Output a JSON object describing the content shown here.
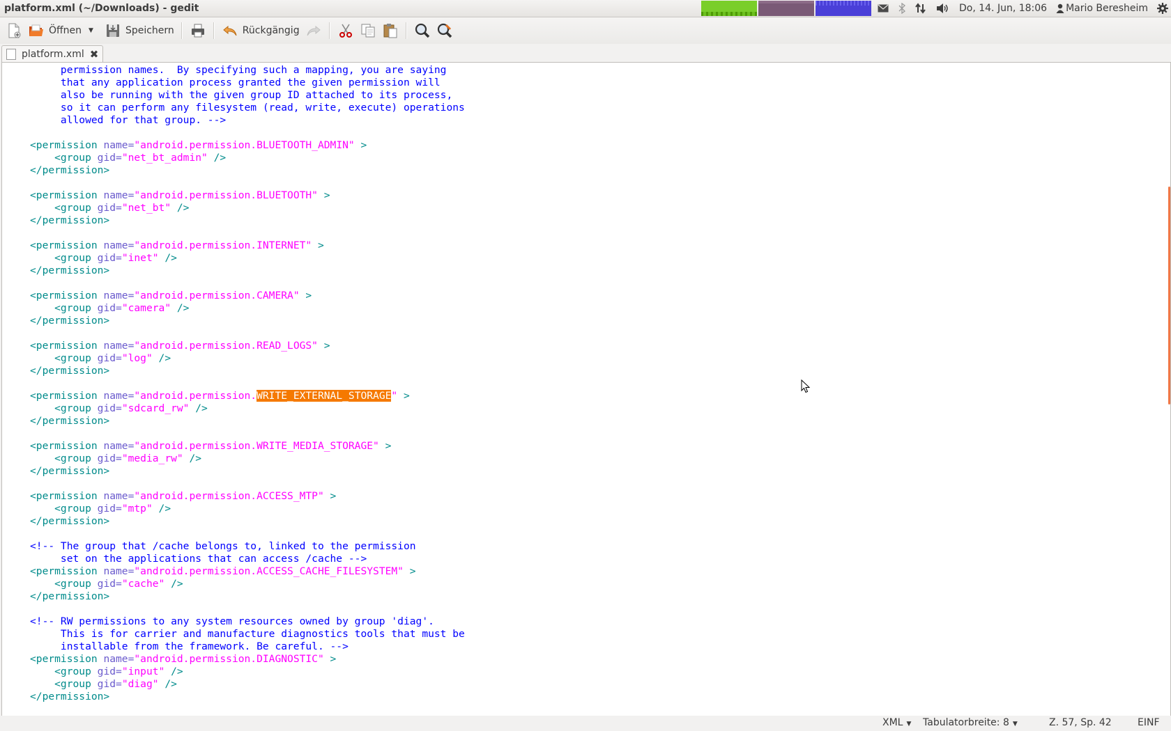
{
  "window": {
    "title": "platform.xml (~/Downloads) - gedit"
  },
  "tray": {
    "date_time": "Do, 14. Jun, 18:06",
    "user": "Mario Beresheim",
    "icons": [
      "mail-icon",
      "bluetooth-icon",
      "network-icon",
      "volume-icon",
      "gear-icon"
    ]
  },
  "toolbar": {
    "new_label": "",
    "open_label": "Öffnen",
    "save_label": "Speichern",
    "undo_label": "Rückgängig"
  },
  "tab": {
    "label": "platform.xml",
    "close_icon": "close-icon"
  },
  "editor": {
    "lines": [
      [
        [
          "c",
          "     permission names.  By specifying such a mapping, you are saying"
        ]
      ],
      [
        [
          "c",
          "     that any application process granted the given permission will"
        ]
      ],
      [
        [
          "c",
          "     also be running with the given group ID attached to its process,"
        ]
      ],
      [
        [
          "c",
          "     so it can perform any filesystem (read, write, execute) operations"
        ]
      ],
      [
        [
          "c",
          "     allowed for that group. -->"
        ]
      ],
      [
        [
          "p",
          ""
        ]
      ],
      [
        [
          "t",
          "<permission "
        ],
        [
          "a",
          "name="
        ],
        [
          "s",
          "\"android.permission.BLUETOOTH_ADMIN\""
        ],
        [
          "t",
          " >"
        ]
      ],
      [
        [
          "t",
          "    <group "
        ],
        [
          "a",
          "gid="
        ],
        [
          "s",
          "\"net_bt_admin\""
        ],
        [
          "t",
          " />"
        ]
      ],
      [
        [
          "t",
          "</permission>"
        ]
      ],
      [
        [
          "p",
          ""
        ]
      ],
      [
        [
          "t",
          "<permission "
        ],
        [
          "a",
          "name="
        ],
        [
          "s",
          "\"android.permission.BLUETOOTH\""
        ],
        [
          "t",
          " >"
        ]
      ],
      [
        [
          "t",
          "    <group "
        ],
        [
          "a",
          "gid="
        ],
        [
          "s",
          "\"net_bt\""
        ],
        [
          "t",
          " />"
        ]
      ],
      [
        [
          "t",
          "</permission>"
        ]
      ],
      [
        [
          "p",
          ""
        ]
      ],
      [
        [
          "t",
          "<permission "
        ],
        [
          "a",
          "name="
        ],
        [
          "s",
          "\"android.permission.INTERNET\""
        ],
        [
          "t",
          " >"
        ]
      ],
      [
        [
          "t",
          "    <group "
        ],
        [
          "a",
          "gid="
        ],
        [
          "s",
          "\"inet\""
        ],
        [
          "t",
          " />"
        ]
      ],
      [
        [
          "t",
          "</permission>"
        ]
      ],
      [
        [
          "p",
          ""
        ]
      ],
      [
        [
          "t",
          "<permission "
        ],
        [
          "a",
          "name="
        ],
        [
          "s",
          "\"android.permission.CAMERA\""
        ],
        [
          "t",
          " >"
        ]
      ],
      [
        [
          "t",
          "    <group "
        ],
        [
          "a",
          "gid="
        ],
        [
          "s",
          "\"camera\""
        ],
        [
          "t",
          " />"
        ]
      ],
      [
        [
          "t",
          "</permission>"
        ]
      ],
      [
        [
          "p",
          ""
        ]
      ],
      [
        [
          "t",
          "<permission "
        ],
        [
          "a",
          "name="
        ],
        [
          "s",
          "\"android.permission.READ_LOGS\""
        ],
        [
          "t",
          " >"
        ]
      ],
      [
        [
          "t",
          "    <group "
        ],
        [
          "a",
          "gid="
        ],
        [
          "s",
          "\"log\""
        ],
        [
          "t",
          " />"
        ]
      ],
      [
        [
          "t",
          "</permission>"
        ]
      ],
      [
        [
          "p",
          ""
        ]
      ],
      [
        [
          "t",
          "<permission "
        ],
        [
          "a",
          "name="
        ],
        [
          "s",
          "\"android.permission."
        ],
        [
          "hl",
          "WRITE_EXTERNAL_STORAGE"
        ],
        [
          "s",
          "\""
        ],
        [
          "t",
          " >"
        ]
      ],
      [
        [
          "t",
          "    <group "
        ],
        [
          "a",
          "gid="
        ],
        [
          "s",
          "\"sdcard_rw\""
        ],
        [
          "t",
          " />"
        ]
      ],
      [
        [
          "t",
          "</permission>"
        ]
      ],
      [
        [
          "p",
          ""
        ]
      ],
      [
        [
          "t",
          "<permission "
        ],
        [
          "a",
          "name="
        ],
        [
          "s",
          "\"android.permission.WRITE_MEDIA_STORAGE\""
        ],
        [
          "t",
          " >"
        ]
      ],
      [
        [
          "t",
          "    <group "
        ],
        [
          "a",
          "gid="
        ],
        [
          "s",
          "\"media_rw\""
        ],
        [
          "t",
          " />"
        ]
      ],
      [
        [
          "t",
          "</permission>"
        ]
      ],
      [
        [
          "p",
          ""
        ]
      ],
      [
        [
          "t",
          "<permission "
        ],
        [
          "a",
          "name="
        ],
        [
          "s",
          "\"android.permission.ACCESS_MTP\""
        ],
        [
          "t",
          " >"
        ]
      ],
      [
        [
          "t",
          "    <group "
        ],
        [
          "a",
          "gid="
        ],
        [
          "s",
          "\"mtp\""
        ],
        [
          "t",
          " />"
        ]
      ],
      [
        [
          "t",
          "</permission>"
        ]
      ],
      [
        [
          "p",
          ""
        ]
      ],
      [
        [
          "c",
          "<!-- The group that /cache belongs to, linked to the permission"
        ]
      ],
      [
        [
          "c",
          "     set on the applications that can access /cache -->"
        ]
      ],
      [
        [
          "t",
          "<permission "
        ],
        [
          "a",
          "name="
        ],
        [
          "s",
          "\"android.permission.ACCESS_CACHE_FILESYSTEM\""
        ],
        [
          "t",
          " >"
        ]
      ],
      [
        [
          "t",
          "    <group "
        ],
        [
          "a",
          "gid="
        ],
        [
          "s",
          "\"cache\""
        ],
        [
          "t",
          " />"
        ]
      ],
      [
        [
          "t",
          "</permission>"
        ]
      ],
      [
        [
          "p",
          ""
        ]
      ],
      [
        [
          "c",
          "<!-- RW permissions to any system resources owned by group 'diag'."
        ]
      ],
      [
        [
          "c",
          "     This is for carrier and manufacture diagnostics tools that must be"
        ]
      ],
      [
        [
          "c",
          "     installable from the framework. Be careful. -->"
        ]
      ],
      [
        [
          "t",
          "<permission "
        ],
        [
          "a",
          "name="
        ],
        [
          "s",
          "\"android.permission.DIAGNOSTIC\""
        ],
        [
          "t",
          " >"
        ]
      ],
      [
        [
          "t",
          "    <group "
        ],
        [
          "a",
          "gid="
        ],
        [
          "s",
          "\"input\""
        ],
        [
          "t",
          " />"
        ]
      ],
      [
        [
          "t",
          "    <group "
        ],
        [
          "a",
          "gid="
        ],
        [
          "s",
          "\"diag\""
        ],
        [
          "t",
          " />"
        ]
      ],
      [
        [
          "t",
          "</permission>"
        ]
      ]
    ]
  },
  "statusbar": {
    "language": "XML",
    "tab_width": "Tabulatorbreite: 8",
    "position": "Z. 57, Sp. 42",
    "mode": "EINF"
  },
  "colors": {
    "tag": "#008b8b",
    "attribute": "#6a5acd",
    "string": "#ff00ff",
    "comment": "#0000ff",
    "highlight": "#f57900"
  }
}
